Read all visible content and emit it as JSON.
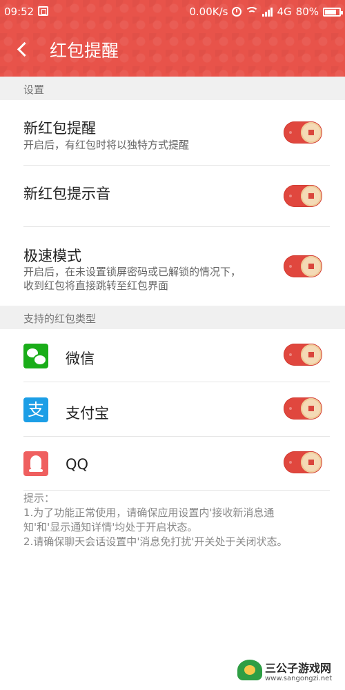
{
  "status_bar": {
    "time": "09:52",
    "network_speed": "0.00K/s",
    "network_type": "4G",
    "battery": "80%"
  },
  "header": {
    "title": "红包提醒",
    "background": "#e8534a"
  },
  "settings_section": {
    "label": "设置",
    "items": [
      {
        "title": "新红包提醒",
        "description": "开启后，有红包时将以独特方式提醒",
        "enabled": true
      },
      {
        "title": "新红包提示音",
        "description": "",
        "enabled": true
      },
      {
        "title": "极速模式",
        "description_lines": [
          "开启后，在未设置锁屏密码或已解锁的情况下，",
          "收到红包将直接跳转至红包界面"
        ],
        "enabled": true
      }
    ]
  },
  "supported_section": {
    "label": "支持的红包类型",
    "apps": [
      {
        "name": "微信",
        "icon": "wechat-icon",
        "enabled": true
      },
      {
        "name": "支付宝",
        "icon": "alipay-icon",
        "icon_glyph": "支",
        "enabled": true
      },
      {
        "name": "QQ",
        "icon": "qq-icon",
        "enabled": true
      }
    ]
  },
  "tips": {
    "heading": "提示：",
    "lines": [
      "1.为了功能正常使用，请确保应用设置内'接收新消息通",
      "知'和'显示通知详情'均处于开启状态。",
      "2.请确保聊天会话设置中'消息免打扰'开关处于关闭状态。"
    ]
  },
  "watermark": {
    "brand": "三公子游戏网",
    "url": "www.sangongzi.net"
  },
  "colors": {
    "accent": "#e8534a",
    "toggle_on": "#e0473e",
    "toggle_knob": "#f4dab6"
  }
}
